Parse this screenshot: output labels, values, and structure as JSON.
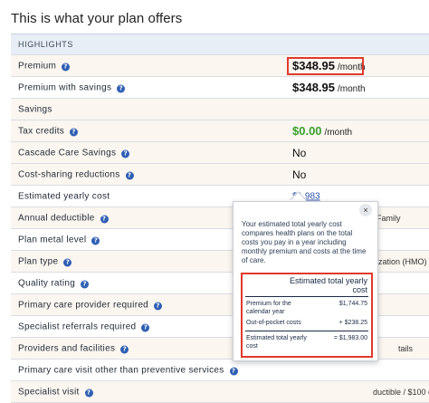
{
  "page": {
    "title": "This is what your plan offers"
  },
  "rows": {
    "highlights": {
      "label": "HIGHLIGHTS"
    },
    "premium": {
      "label": "Premium",
      "amount": "$348.95",
      "unit": "/month"
    },
    "premium_with_savings": {
      "label": "Premium with savings",
      "amount": "$348.95",
      "unit": "/month"
    },
    "savings": {
      "label": "Savings"
    },
    "tax_credits": {
      "label": "Tax credits",
      "amount": "$0.00",
      "unit": "/month"
    },
    "cascade_care_savings": {
      "label": "Cascade Care Savings",
      "value": "No"
    },
    "cost_sharing": {
      "label": "Cost-sharing reductions",
      "value": "No"
    },
    "estimated_yearly_cost": {
      "label": "Estimated yearly cost",
      "value": "$1,983"
    },
    "annual_deductible": {
      "label": "Annual deductible",
      "partial": "Family"
    },
    "plan_metal_level": {
      "label": "Plan metal level"
    },
    "plan_type": {
      "label": "Plan type",
      "partial": "ization (HMO)"
    },
    "quality_rating": {
      "label": "Quality rating"
    },
    "primary_care_provider": {
      "label": "Primary care provider required"
    },
    "specialist_referrals": {
      "label": "Specialist referrals required"
    },
    "providers_facilities": {
      "label": "Providers and facilities",
      "partial": "tails"
    },
    "primary_care_visit": {
      "label": "Primary care visit other than preventive services"
    },
    "specialist_visit": {
      "label": "Specialist visit",
      "partial": "ductible / $100 co"
    }
  },
  "popup": {
    "close_glyph": "×",
    "description": "Your estimated total yearly cost compares health plans on the total costs you pay in a year including monthly premium and costs at the time of care.",
    "breakdown_title": "Estimated total yearly cost",
    "items": [
      {
        "label": "Premium for the calendar year",
        "amount": "$1,744.75"
      },
      {
        "label": "Out-of-pocket costs",
        "amount": "+ $238.25"
      }
    ],
    "total": {
      "label": "Estimated total yearly cost",
      "amount": "= $1,983.00"
    }
  },
  "colors": {
    "accent_blue": "#2f5fb3",
    "highlight_red": "#e03a2c",
    "savings_green": "#3aa02f",
    "shaded_row": "#fbf6f0",
    "header_row": "#e8eef6"
  },
  "icons": {
    "info": "info-icon",
    "close": "close-icon"
  }
}
